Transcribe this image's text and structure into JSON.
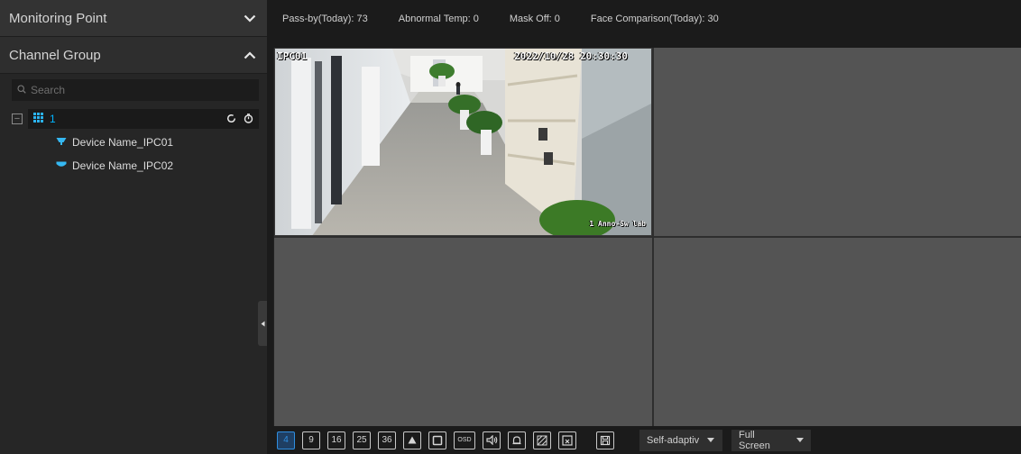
{
  "left_panel": {
    "monitoring_point": "Monitoring Point",
    "channel_group": "Channel Group",
    "search_placeholder": "Search",
    "group_name": "1",
    "devices": [
      "Device Name_IPC01",
      "Device Name_IPC02"
    ]
  },
  "stats": {
    "pass_by": "Pass-by(Today): 73",
    "abnormal_temp": "Abnormal Temp: 0",
    "mask_off": "Mask Off: 0",
    "face_comparison": "Face Comparison(Today): 30"
  },
  "video": {
    "channel_osd": "IPC01",
    "timestamp_osd": "2022/10/28 20:30:30",
    "location_osd": "1 Anno-Sw lab"
  },
  "toolbar": {
    "layouts": [
      "4",
      "9",
      "16",
      "25",
      "36"
    ],
    "osd_label": "OSD",
    "aspect_select": "Self-adaptiv",
    "screen_select": "Full Screen"
  },
  "colors": {
    "accent": "#2f8ee0",
    "group_text": "#00b4ff",
    "device_icon": "#35b8f2"
  },
  "icons": {
    "header_collapse": "chevron-down-icon",
    "header_expand": "chevron-up-icon",
    "search": "search-icon",
    "group": "grid-icon",
    "device": "camera-icon"
  }
}
